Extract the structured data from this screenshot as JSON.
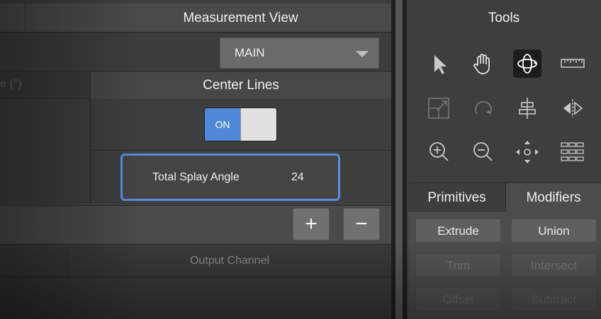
{
  "left_panel": {
    "title": "Measurement View",
    "view_select": {
      "value": "MAIN"
    },
    "column_header_fragment": "e (°)",
    "center_lines": {
      "header": "Center Lines",
      "toggle_on_label": "ON",
      "toggle_state": "on"
    },
    "splay": {
      "label": "Total Splay Angle",
      "value": "24"
    },
    "buttons": {
      "add": "+",
      "remove": "−"
    },
    "output_header": "Output Channel"
  },
  "tools_panel": {
    "title": "Tools",
    "tools": [
      {
        "icon": "pointer-arrow-icon",
        "glyph": "➤",
        "state": "normal"
      },
      {
        "icon": "hand-pan-icon",
        "glyph": "✋",
        "state": "normal"
      },
      {
        "icon": "orbit-rotate-icon",
        "glyph": "✥",
        "state": "selected"
      },
      {
        "icon": "ruler-icon",
        "glyph": "▭",
        "state": "normal"
      },
      {
        "icon": "scale-box-icon",
        "glyph": "⇲",
        "state": "dim"
      },
      {
        "icon": "rotate-arc-icon",
        "glyph": "↻",
        "state": "dim"
      },
      {
        "icon": "align-center-icon",
        "glyph": "≑",
        "state": "normal"
      },
      {
        "icon": "mirror-icon",
        "glyph": "⧓",
        "state": "normal"
      },
      {
        "icon": "zoom-in-icon",
        "glyph": "⊕",
        "state": "normal"
      },
      {
        "icon": "zoom-out-icon",
        "glyph": "⊖",
        "state": "normal"
      },
      {
        "icon": "move-arrows-icon",
        "glyph": "✣",
        "state": "normal"
      },
      {
        "icon": "grid-layout-icon",
        "glyph": "▦",
        "state": "normal"
      }
    ],
    "tabs": [
      {
        "label": "Primitives",
        "active": false
      },
      {
        "label": "Modifiers",
        "active": true
      }
    ],
    "modifiers": [
      {
        "label": "Extrude",
        "enabled": true
      },
      {
        "label": "Union",
        "enabled": true
      },
      {
        "label": "Trim",
        "enabled": false
      },
      {
        "label": "Intersect",
        "enabled": false
      },
      {
        "label": "Offset",
        "enabled": false
      },
      {
        "label": "Subtract",
        "enabled": false
      }
    ]
  },
  "colors": {
    "accent": "#4e88d6",
    "highlight_border": "#5b8de0",
    "panel_bg": "#3e3e3e"
  }
}
